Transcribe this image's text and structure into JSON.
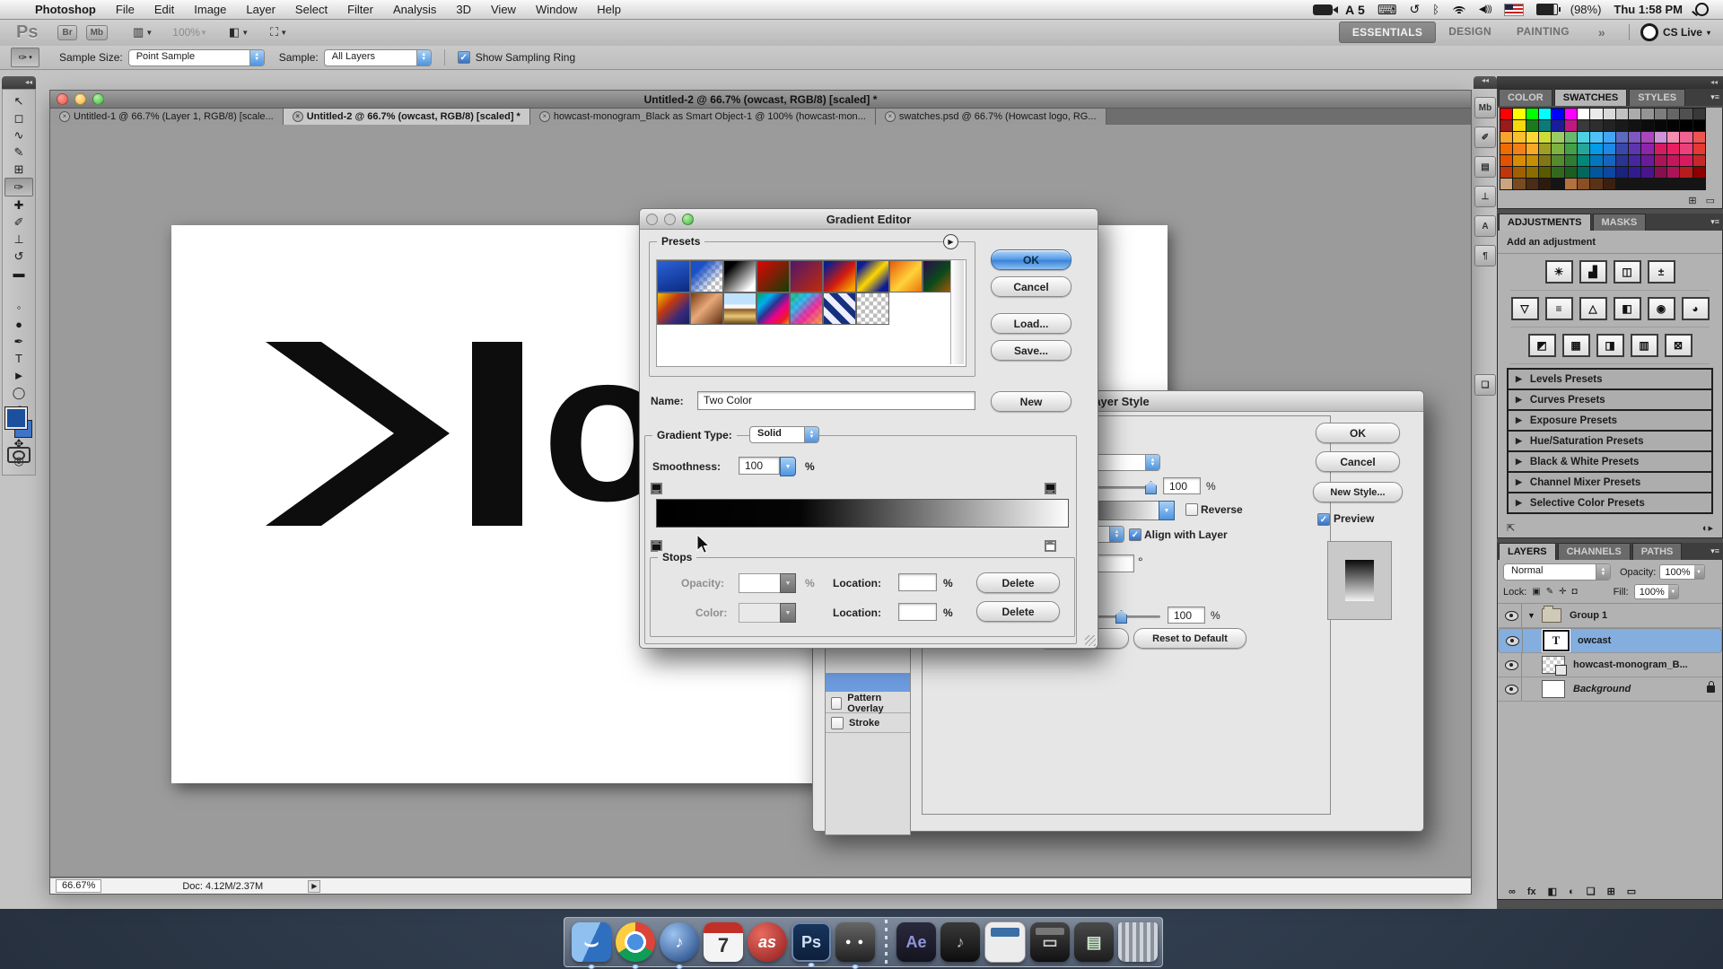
{
  "menubar": {
    "apple": "",
    "items": [
      {
        "label": "Photoshop",
        "cls": "bold"
      },
      {
        "label": "File",
        "cls": ""
      },
      {
        "label": "Edit",
        "cls": ""
      },
      {
        "label": "Image",
        "cls": ""
      },
      {
        "label": "Layer",
        "cls": ""
      },
      {
        "label": "Select",
        "cls": ""
      },
      {
        "label": "Filter",
        "cls": ""
      },
      {
        "label": "Analysis",
        "cls": ""
      },
      {
        "label": "3D",
        "cls": ""
      },
      {
        "label": "View",
        "cls": ""
      },
      {
        "label": "Window",
        "cls": ""
      },
      {
        "label": "Help",
        "cls": ""
      }
    ],
    "status": {
      "adobe_letter": "A",
      "adobe_count": "5",
      "keyboard_glyph": "⌨",
      "time_machine_glyph": "↺",
      "bluetooth_glyph": "ᛒ",
      "volume_glyph": "◀)))",
      "battery_pct": "(98%)",
      "clock": "Thu 1:58 PM"
    }
  },
  "app_bar": {
    "ps_logo": "Ps",
    "bridge": "Br",
    "mini_bridge": "Mb",
    "zoom_level": "100%",
    "view_arrow": "▼",
    "workspaces": [
      {
        "label": "ESSENTIALS",
        "cls": "active"
      },
      {
        "label": "DESIGN",
        "cls": ""
      },
      {
        "label": "PAINTING",
        "cls": ""
      }
    ],
    "overflow": "»",
    "cs_live": "CS Live",
    "cs_live_arrow": "▾"
  },
  "options_bar": {
    "tool_glyph": "✑",
    "sample_size_label": "Sample Size:",
    "sample_size_value": "Point Sample",
    "sample_label": "Sample:",
    "sample_value": "All Layers",
    "sampling_ring_label": "Show Sampling Ring"
  },
  "document": {
    "window_title": "Untitled-2 @ 66.7% (owcast, RGB/8) [scaled] *",
    "tabs": [
      {
        "label": "Untitled-1 @ 66.7% (Layer 1, RGB/8) [scale...",
        "cls": ""
      },
      {
        "label": "Untitled-2 @ 66.7% (owcast, RGB/8) [scaled] *",
        "cls": "active"
      },
      {
        "label": "howcast-monogram_Black as Smart Object-1 @ 100% (howcast-mon...",
        "cls": ""
      },
      {
        "label": "swatches.psd @ 66.7% (Howcast logo, RG...",
        "cls": ""
      }
    ],
    "logo_text": "ow",
    "status_zoom": "66.67%",
    "status_doc": "Doc: 4.12M/2.37M"
  },
  "toolbar": {
    "tools": [
      {
        "name": "move-tool",
        "glyph": "↖",
        "cls": ""
      },
      {
        "name": "marquee-tool",
        "glyph": "◻",
        "cls": ""
      },
      {
        "name": "lasso-tool",
        "glyph": "∿",
        "cls": ""
      },
      {
        "name": "quick-selection-tool",
        "glyph": "✎",
        "cls": ""
      },
      {
        "name": "crop-tool",
        "glyph": "⊞",
        "cls": ""
      },
      {
        "name": "eyedropper-tool",
        "glyph": "✑",
        "cls": "sel"
      },
      {
        "name": "healing-brush-tool",
        "glyph": "✚",
        "cls": ""
      },
      {
        "name": "brush-tool",
        "glyph": "✐",
        "cls": ""
      },
      {
        "name": "clone-stamp-tool",
        "glyph": "⊥",
        "cls": ""
      },
      {
        "name": "history-brush-tool",
        "glyph": "↺",
        "cls": ""
      },
      {
        "name": "eraser-tool",
        "glyph": "▬",
        "cls": ""
      },
      {
        "name": "gradient-tool",
        "glyph": "",
        "cls": "grad"
      },
      {
        "name": "blur-tool",
        "glyph": "◦",
        "cls": ""
      },
      {
        "name": "dodge-tool",
        "glyph": "●",
        "cls": ""
      },
      {
        "name": "pen-tool",
        "glyph": "✒",
        "cls": ""
      },
      {
        "name": "type-tool",
        "glyph": "T",
        "cls": ""
      },
      {
        "name": "path-selection-tool",
        "glyph": "►",
        "cls": ""
      },
      {
        "name": "shape-tool",
        "glyph": "◯",
        "cls": ""
      },
      {
        "name": "3d-rotate-tool",
        "glyph": "⟲",
        "cls": ""
      },
      {
        "name": "3d-orbit-tool",
        "glyph": "⟳",
        "cls": ""
      },
      {
        "name": "hand-tool",
        "glyph": "✥",
        "cls": ""
      },
      {
        "name": "zoom-tool",
        "glyph": "◎",
        "cls": ""
      }
    ]
  },
  "panel_strip": {
    "icons": [
      {
        "name": "mini-bridge-panel-icon",
        "glyph": "Mb",
        "cls": ""
      },
      {
        "name": "brush-panel-icon",
        "glyph": "✐",
        "cls": ""
      },
      {
        "name": "tool-presets-panel-icon",
        "glyph": "▤",
        "cls": ""
      },
      {
        "name": "clone-source-panel-icon",
        "glyph": "⊥",
        "cls": ""
      },
      {
        "name": "character-panel-icon",
        "glyph": "A",
        "cls": ""
      },
      {
        "name": "paragraph-panel-icon",
        "glyph": "¶",
        "cls": ""
      },
      {
        "name": "layer-comps-panel-icon",
        "glyph": "❏",
        "cls": "gap"
      }
    ]
  },
  "gradient_editor": {
    "title": "Gradient Editor",
    "presets_label": "Presets",
    "ok": "OK",
    "cancel": "Cancel",
    "load": "Load...",
    "save": "Save...",
    "new": "New",
    "name_label": "Name:",
    "name_value": "Two Color",
    "gradient_type_label": "Gradient Type:",
    "gradient_type_value": "Solid",
    "smoothness_label": "Smoothness:",
    "smoothness_value": "100",
    "pct": "%",
    "stops_label": "Stops",
    "opacity_label": "Opacity:",
    "color_label": "Color:",
    "location_label": "Location:",
    "delete_label": "Delete",
    "presets_swatches": [
      "g-blue",
      "g-blue-transparent",
      "g-black-white",
      "g-red-green",
      "g-violet-orange",
      "g-blue-red-yellow",
      "g-blue-yellow-blue",
      "g-orange-yellow",
      "g-violet-green-orange",
      "g-yellow-violet-orange-blue",
      "g-copper",
      "g-chrome",
      "g-spectrum",
      "g-transparent-rainbow",
      "g-transparent-stripes",
      "g-transparency"
    ]
  },
  "layer_style": {
    "title": "Layer Style",
    "ok": "OK",
    "cancel": "Cancel",
    "new_style": "New Style...",
    "preview_label": "Preview",
    "opacity_value": "100",
    "pct": "%",
    "reverse_label": "Reverse",
    "align_label": "Align with Layer",
    "degree": "°",
    "scale_value": "100",
    "reset_label": "Reset to Default",
    "style_items": [
      {
        "label": "Pattern Overlay"
      },
      {
        "label": "Stroke"
      }
    ]
  },
  "panels": {
    "swatches": {
      "tabs": [
        {
          "label": "COLOR",
          "cls": ""
        },
        {
          "label": "SWATCHES",
          "cls": "active"
        },
        {
          "label": "STYLES",
          "cls": ""
        }
      ],
      "colors": [
        "#ff0000",
        "#ffff00",
        "#00ff00",
        "#00ffff",
        "#0000ff",
        "#ff00ff",
        "#ffffff",
        "#ebebeb",
        "#d9d9d9",
        "#c2c2c2",
        "#ababab",
        "#949494",
        "#7d7d7d",
        "#666666",
        "#505050",
        "#393939",
        "#9b1b1b",
        "#f5d90a",
        "#1b7a1b",
        "#0a7a7a",
        "#1b1b9b",
        "#c01880",
        "#3a3a3a",
        "#2e2e2e",
        "#232323",
        "#1a1a1a",
        "#121212",
        "#0c0c0c",
        "#070707",
        "#030303",
        "#000000",
        "#000000",
        "#f7a32d",
        "#fbc02d",
        "#fdd835",
        "#cddc39",
        "#9ccc65",
        "#66bb6a",
        "#4dd0e1",
        "#4fc3f7",
        "#42a5f5",
        "#5c6bc0",
        "#7e57c2",
        "#ab47bc",
        "#ce93d8",
        "#f48fb1",
        "#f06292",
        "#ef5350",
        "#ef6c00",
        "#f57f17",
        "#f9a825",
        "#9e9d24",
        "#7cb342",
        "#43a047",
        "#26a69a",
        "#039be5",
        "#1e88e5",
        "#3949ab",
        "#5e35b1",
        "#8e24aa",
        "#d81b60",
        "#e91e63",
        "#ec407a",
        "#e53935",
        "#e65100",
        "#d98c00",
        "#c49000",
        "#827717",
        "#558b2f",
        "#2e7d32",
        "#00897b",
        "#0277bd",
        "#1565c0",
        "#283593",
        "#4527a0",
        "#6a1b9a",
        "#ad1457",
        "#c2185b",
        "#d81b60",
        "#c62828",
        "#bf360c",
        "#a06000",
        "#8a6d00",
        "#5a5a00",
        "#33691e",
        "#1b5e20",
        "#00695c",
        "#01579b",
        "#0d47a1",
        "#1a237e",
        "#311b92",
        "#4a148c",
        "#880e4f",
        "#ad1457",
        "#b71c1c",
        "#8e0000",
        "#caa57e",
        "#7a4a21",
        "#4a2c17",
        "#2f1b0e",
        "",
        "#b5713f",
        "#8a4f24",
        "#5a3317",
        "#3a2010",
        "",
        "",
        "",
        "",
        "",
        "",
        ""
      ],
      "new_swatch_glyph": "⊞",
      "trash_glyph": "▭"
    },
    "adjustments": {
      "tabs": [
        {
          "label": "ADJUSTMENTS",
          "cls": "active"
        },
        {
          "label": "MASKS",
          "cls": ""
        }
      ],
      "heading": "Add an adjustment",
      "row1": [
        {
          "name": "brightness-contrast-icon",
          "glyph": "☀"
        },
        {
          "name": "levels-icon",
          "glyph": "▟"
        },
        {
          "name": "curves-icon",
          "glyph": "◫"
        },
        {
          "name": "exposure-icon",
          "glyph": "±"
        }
      ],
      "row2": [
        {
          "name": "vibrance-icon",
          "glyph": "▽"
        },
        {
          "name": "hue-saturation-icon",
          "glyph": "≡"
        },
        {
          "name": "color-balance-icon",
          "glyph": "△"
        },
        {
          "name": "black-white-icon",
          "glyph": "◧"
        },
        {
          "name": "photo-filter-icon",
          "glyph": "◉"
        },
        {
          "name": "channel-mixer-icon",
          "glyph": "◕"
        }
      ],
      "row3": [
        {
          "name": "invert-icon",
          "glyph": "◩"
        },
        {
          "name": "posterize-icon",
          "glyph": "▦"
        },
        {
          "name": "threshold-icon",
          "glyph": "◨"
        },
        {
          "name": "gradient-map-icon",
          "glyph": "▥"
        },
        {
          "name": "selective-color-icon",
          "glyph": "⊠"
        }
      ],
      "presets": [
        {
          "label": "Levels Presets"
        },
        {
          "label": "Curves Presets"
        },
        {
          "label": "Exposure Presets"
        },
        {
          "label": "Hue/Saturation Presets"
        },
        {
          "label": "Black & White Presets"
        },
        {
          "label": "Channel Mixer Presets"
        },
        {
          "label": "Selective Color Presets"
        }
      ]
    },
    "layers": {
      "tabs": [
        {
          "label": "LAYERS",
          "cls": "active"
        },
        {
          "label": "CHANNELS",
          "cls": ""
        },
        {
          "label": "PATHS",
          "cls": ""
        }
      ],
      "blend_mode": "Normal",
      "opacity_label": "Opacity:",
      "opacity_value": "100%",
      "lock_label": "Lock:",
      "fill_label": "Fill:",
      "fill_value": "100%",
      "rows": [
        {
          "name": "Group 1",
          "cls": "",
          "thumb": "th-group",
          "exp": "▼",
          "namecls": "",
          "lockcls": "",
          "tglyph": ""
        },
        {
          "name": "owcast",
          "cls": "sel",
          "thumb": "th-text",
          "exp": "",
          "namecls": "",
          "lockcls": "",
          "tglyph": "T"
        },
        {
          "name": "howcast-monogram_B...",
          "cls": "",
          "thumb": "th-smart",
          "exp": "",
          "namecls": "",
          "lockcls": "",
          "tglyph": ""
        },
        {
          "name": "Background",
          "cls": "",
          "thumb": "th-bg",
          "exp": "",
          "namecls": "italic",
          "lockcls": "show",
          "tglyph": ""
        }
      ],
      "footer_icons": [
        {
          "name": "link-layers-icon",
          "glyph": "∞"
        },
        {
          "name": "layer-effects-icon",
          "glyph": "fx"
        },
        {
          "name": "layer-mask-icon",
          "glyph": "◧"
        },
        {
          "name": "adjustment-layer-icon",
          "glyph": "◐"
        },
        {
          "name": "layer-group-icon",
          "glyph": "❏"
        },
        {
          "name": "new-layer-icon",
          "glyph": "⊞"
        },
        {
          "name": "delete-layer-icon",
          "glyph": "▭"
        }
      ]
    }
  },
  "dock": {
    "apps": [
      {
        "name": "dock-finder",
        "glyph": "⌣",
        "cls": "dk-finder running"
      },
      {
        "name": "dock-chrome",
        "glyph": "",
        "cls": "dk-chrome running"
      },
      {
        "name": "dock-itunes",
        "glyph": "♪",
        "cls": "dk-itunes running"
      },
      {
        "name": "dock-ical",
        "glyph": "7",
        "cls": "dk-ical"
      },
      {
        "name": "dock-lastfm",
        "glyph": "as",
        "cls": "dk-lastfm"
      },
      {
        "name": "dock-photoshop",
        "glyph": "Ps",
        "cls": "dk-ps running"
      },
      {
        "name": "dock-movie-player",
        "glyph": "● ●",
        "cls": "dk-qt running"
      },
      {
        "name": "dock-separator",
        "glyph": "",
        "cls": "dk-sep"
      },
      {
        "name": "dock-after-effects",
        "glyph": "Ae",
        "cls": "dk-ae"
      },
      {
        "name": "dock-music-app",
        "glyph": "♪",
        "cls": "dk-music"
      },
      {
        "name": "dock-browser-window",
        "glyph": "",
        "cls": "dk-win1"
      },
      {
        "name": "dock-dark-window",
        "glyph": "▭",
        "cls": "dk-win2"
      },
      {
        "name": "dock-grid-app",
        "glyph": "▤",
        "cls": "dk-grid"
      },
      {
        "name": "dock-trash",
        "glyph": "",
        "cls": "dk-trash"
      }
    ]
  }
}
